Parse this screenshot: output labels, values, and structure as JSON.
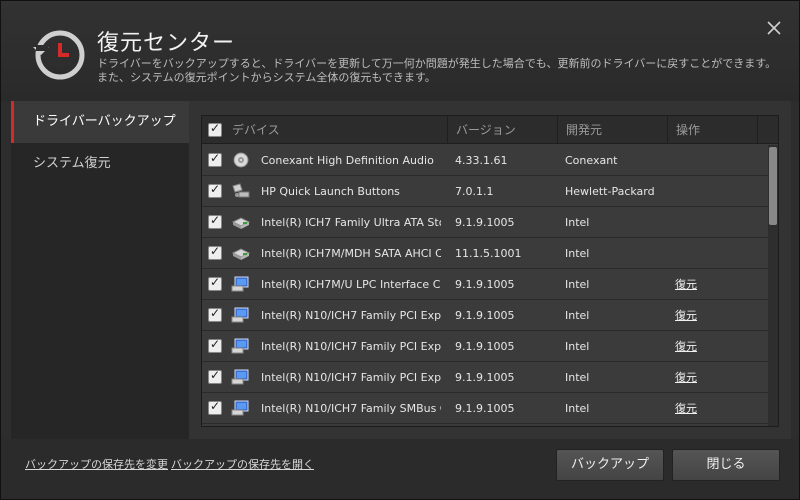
{
  "header": {
    "title": "復元センター",
    "description": "ドライバーをバックアップすると、ドライバーを更新して万一何か問題が発生した場合でも、更新前のドライバーに戻すことができます。また、システムの復元ポイントからシステム全体の復元もできます。"
  },
  "sidebar": {
    "items": [
      {
        "label": "ドライバーバックアップ",
        "active": true
      },
      {
        "label": "システム復元",
        "active": false
      }
    ]
  },
  "table": {
    "columns": [
      "デバイス",
      "バージョン",
      "開発元",
      "操作"
    ],
    "rows": [
      {
        "name": "Conexant High Definition Audio",
        "version": "4.33.1.61",
        "vendor": "Conexant",
        "action": "",
        "icon": "audio-icon"
      },
      {
        "name": "HP Quick Launch Buttons",
        "version": "7.0.1.1",
        "vendor": "Hewlett-Packard",
        "action": "",
        "icon": "keyboard-icon"
      },
      {
        "name": "Intel(R) ICH7 Family Ultra ATA Sto...",
        "version": "9.1.9.1005",
        "vendor": "Intel",
        "action": "",
        "icon": "drive-icon"
      },
      {
        "name": "Intel(R) ICH7M/MDH SATA AHCI C...",
        "version": "11.1.5.1001",
        "vendor": "Intel",
        "action": "",
        "icon": "drive-icon"
      },
      {
        "name": "Intel(R) ICH7M/U LPC Interface C...",
        "version": "9.1.9.1005",
        "vendor": "Intel",
        "action": "復元",
        "icon": "monitor-icon"
      },
      {
        "name": "Intel(R) N10/ICH7 Family PCI Expr...",
        "version": "9.1.9.1005",
        "vendor": "Intel",
        "action": "復元",
        "icon": "monitor-icon"
      },
      {
        "name": "Intel(R) N10/ICH7 Family PCI Expr...",
        "version": "9.1.9.1005",
        "vendor": "Intel",
        "action": "復元",
        "icon": "monitor-icon"
      },
      {
        "name": "Intel(R) N10/ICH7 Family PCI Expr...",
        "version": "9.1.9.1005",
        "vendor": "Intel",
        "action": "復元",
        "icon": "monitor-icon"
      },
      {
        "name": "Intel(R) N10/ICH7 Family SMBus C...",
        "version": "9.1.9.1005",
        "vendor": "Intel",
        "action": "復元",
        "icon": "monitor-icon"
      }
    ]
  },
  "footer": {
    "link_change": "バックアップの保存先を変更",
    "link_open": "バックアップの保存先を開く",
    "backup_button": "バックアップ",
    "close_button": "閉じる"
  },
  "colors": {
    "accent": "#d42a2a",
    "background": "#2d2d2d"
  }
}
